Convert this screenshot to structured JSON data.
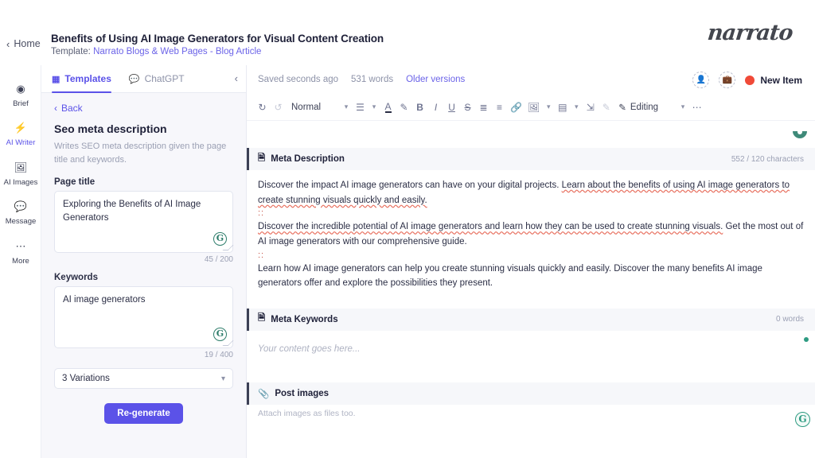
{
  "topbar": {
    "home_label": "Home",
    "home_icon": "chevron-left-icon",
    "doc_title": "Benefits of Using AI Image Generators for Visual Content Creation",
    "template_prefix": "Template:",
    "template_name": "Narrato Blogs & Web Pages - Blog Article",
    "brand": "narrato"
  },
  "rail": {
    "items": [
      {
        "label": "Brief",
        "icon": "target-icon"
      },
      {
        "label": "AI Writer",
        "icon": "lightning-bolt-icon"
      },
      {
        "label": "AI Images",
        "icon": "image-icon"
      },
      {
        "label": "Message",
        "icon": "chat-bubble-icon"
      },
      {
        "label": "More",
        "icon": "ellipsis-icon"
      }
    ],
    "active_index": 1
  },
  "panel": {
    "tabs": [
      {
        "label": "Templates",
        "icon": "grid-icon"
      },
      {
        "label": "ChatGPT",
        "icon": "chat-icon"
      }
    ],
    "active_tab": 0,
    "collapse_icon": "chevron-left-icon",
    "back_label": "Back",
    "title": "Seo meta description",
    "description": "Writes SEO meta description given the page title and keywords.",
    "fields": [
      {
        "label": "Page title",
        "value": "Exploring the Benefits of AI Image Generators",
        "counter": "45 / 200",
        "assist_icon": "grammarly-icon"
      },
      {
        "label": "Keywords",
        "value": "AI image generators",
        "counter": "19 / 400",
        "assist_icon": "grammarly-icon"
      }
    ],
    "variations_select": "3 Variations",
    "regenerate_label": "Re-generate"
  },
  "editor": {
    "status": {
      "saved": "Saved seconds ago",
      "words": "531 words",
      "versions_link": "Older versions"
    },
    "actions": {
      "share_icon": "add-person-icon",
      "briefcase_icon": "add-folder-icon",
      "new_item_label": "New Item",
      "new_item_dot_color": "#f04a38"
    },
    "toolbar": {
      "undo_icon": "undo-icon",
      "redo_icon": "redo-icon",
      "style_label": "Normal",
      "style_chevron": "chevron-down-icon",
      "align_icon": "align-left-icon",
      "align_chevron": "chevron-down-icon",
      "text_color_icon": "text-color-icon",
      "highlight_icon": "highlighter-icon",
      "bold_icon": "bold-icon",
      "italic_icon": "italic-icon",
      "underline_icon": "underline-icon",
      "strikethrough_icon": "strikethrough-icon",
      "bullet_list_icon": "bullet-list-icon",
      "numbered_list_icon": "numbered-list-icon",
      "link_icon": "link-icon",
      "image_icon": "image-icon",
      "image_chevron": "chevron-down-icon",
      "table_icon": "table-icon",
      "table_chevron": "chevron-down-icon",
      "clear_format_icon": "clear-formatting-icon",
      "comment_icon": "comment-icon",
      "mode_icon": "pencil-icon",
      "mode_label": "Editing",
      "mode_chevron": "chevron-down-icon",
      "more_icon": "ellipsis-icon"
    },
    "sections": [
      {
        "title": "Meta Description",
        "icon": "document-icon",
        "counter": "552 / 120 characters",
        "subtitle": "",
        "paragraphs": [
          {
            "plain": "Discover the impact AI image generators can have on your digital projects. ",
            "spelled": "Learn about the benefits of using AI image generators to create stunning visuals quickly and easily."
          },
          {
            "plain": "",
            "spelled": "Discover the incredible potential of AI image generators and learn how they can be used to create stunning visuals.",
            "tail": " Get the most out of AI image generators with our comprehensive guide."
          },
          {
            "plain": "Learn how AI image generators can help you create stunning visuals quickly and easily. Discover the many benefits AI image generators offer and explore the possibilities they present.",
            "spelled": ""
          }
        ],
        "separator": "::"
      },
      {
        "title": "Meta Keywords",
        "icon": "document-icon",
        "counter": "0 words",
        "subtitle": "",
        "placeholder": "Your content goes here...",
        "assist_icon": "grammarly-icon"
      },
      {
        "title": "Post images",
        "icon": "attachment-icon",
        "counter": "",
        "subtitle": "Attach images as files too."
      }
    ]
  },
  "colors": {
    "accent": "#5b52e8",
    "link": "#6b63e8",
    "red_dot": "#f04a38",
    "grammarly_green": "#2e9b82",
    "spell_error": "#e8705f"
  }
}
